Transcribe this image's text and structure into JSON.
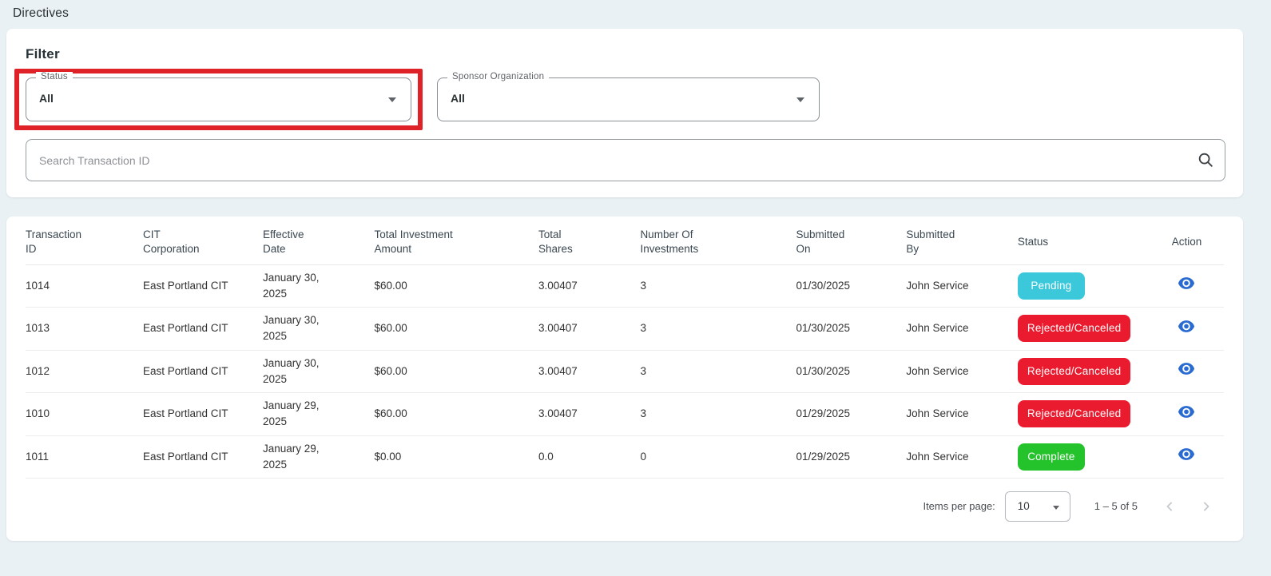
{
  "page": {
    "title": "Directives"
  },
  "filter": {
    "heading": "Filter",
    "status": {
      "label": "Status",
      "value": "All"
    },
    "sponsor_organization": {
      "label": "Sponsor Organization",
      "value": "All"
    },
    "search": {
      "placeholder": "Search Transaction ID"
    }
  },
  "table": {
    "columns": [
      "Transaction ID",
      "CIT Corporation",
      "Effective Date",
      "Total Investment Amount",
      "Total Shares",
      "Number Of Investments",
      "Submitted On",
      "Submitted By",
      "Status",
      "Action"
    ],
    "rows": [
      {
        "transaction_id": "1014",
        "cit_corporation": "East Portland CIT",
        "effective_date": "January 30, 2025",
        "total_investment_amount": "$60.00",
        "total_shares": "3.00407",
        "number_of_investments": "3",
        "submitted_on": "01/30/2025",
        "submitted_by": "John Service",
        "status": "Pending"
      },
      {
        "transaction_id": "1013",
        "cit_corporation": "East Portland CIT",
        "effective_date": "January 30, 2025",
        "total_investment_amount": "$60.00",
        "total_shares": "3.00407",
        "number_of_investments": "3",
        "submitted_on": "01/30/2025",
        "submitted_by": "John Service",
        "status": "Rejected/Canceled"
      },
      {
        "transaction_id": "1012",
        "cit_corporation": "East Portland CIT",
        "effective_date": "January 30, 2025",
        "total_investment_amount": "$60.00",
        "total_shares": "3.00407",
        "number_of_investments": "3",
        "submitted_on": "01/30/2025",
        "submitted_by": "John Service",
        "status": "Rejected/Canceled"
      },
      {
        "transaction_id": "1010",
        "cit_corporation": "East Portland CIT",
        "effective_date": "January 29, 2025",
        "total_investment_amount": "$60.00",
        "total_shares": "3.00407",
        "number_of_investments": "3",
        "submitted_on": "01/29/2025",
        "submitted_by": "John Service",
        "status": "Rejected/Canceled"
      },
      {
        "transaction_id": "1011",
        "cit_corporation": "East Portland CIT",
        "effective_date": "January 29, 2025",
        "total_investment_amount": "$0.00",
        "total_shares": "0.0",
        "number_of_investments": "0",
        "submitted_on": "01/29/2025",
        "submitted_by": "John Service",
        "status": "Complete"
      }
    ]
  },
  "paginator": {
    "items_per_page_label": "Items per page:",
    "page_size": "10",
    "range_label": "1 – 5 of 5"
  },
  "icons": {
    "search": "search-icon",
    "select_caret": "chevron-down-icon",
    "action": "eye-icon",
    "previous": "chevron-left-icon",
    "next": "chevron-right-icon"
  },
  "colors": {
    "page-bg": "#e9f1f5",
    "highlight-red": "#df2228",
    "status-pending": "#3bc8da",
    "status-rejected": "#ea1b2e",
    "status-complete": "#24c32b",
    "action-blue": "#2a6bd2"
  }
}
